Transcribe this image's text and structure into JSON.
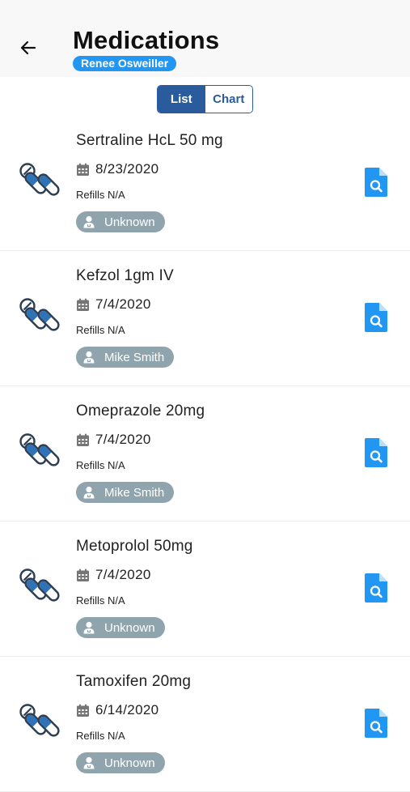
{
  "header": {
    "title": "Medications",
    "patient_name": "Renee Osweiller",
    "back_icon": "arrow-left-icon"
  },
  "view_toggle": {
    "options": [
      "List",
      "Chart"
    ],
    "selected": "List"
  },
  "colors": {
    "accent": "#2196f3",
    "segment_active": "#2a5b9c",
    "prescriber_badge": "#90a4ae",
    "pill_icon_blue": "#2f72b8",
    "pill_icon_dark": "#2d3d52"
  },
  "medications": [
    {
      "name": "Sertraline HcL 50 mg",
      "date": "8/23/2020",
      "refills": "Refills N/A",
      "prescriber": "Unknown"
    },
    {
      "name": "Kefzol 1gm IV",
      "date": "7/4/2020",
      "refills": "Refills N/A",
      "prescriber": "Mike Smith"
    },
    {
      "name": "Omeprazole 20mg",
      "date": "7/4/2020",
      "refills": "Refills N/A",
      "prescriber": "Mike Smith"
    },
    {
      "name": "Metoprolol 50mg",
      "date": "7/4/2020",
      "refills": "Refills N/A",
      "prescriber": "Unknown"
    },
    {
      "name": "Tamoxifen 20mg",
      "date": "6/14/2020",
      "refills": "Refills N/A",
      "prescriber": "Unknown"
    }
  ]
}
